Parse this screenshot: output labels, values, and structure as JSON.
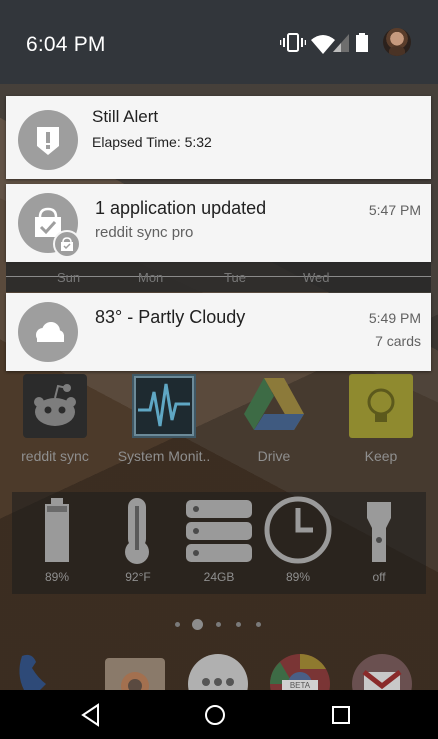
{
  "status_bar": {
    "time": "6:04 PM",
    "icons": [
      "vibrate-icon",
      "wifi-icon",
      "signal-icon",
      "battery-icon",
      "avatar"
    ]
  },
  "notifications": [
    {
      "id": "still-alert",
      "icon": "alert-shield-icon",
      "title": "Still Alert",
      "subtitle": "Elapsed Time: 5:32"
    },
    {
      "id": "app-updated",
      "icon": "shopping-bag-check-icon",
      "title": "1 application updated",
      "subtitle": "reddit sync pro",
      "time": "5:47 PM"
    },
    {
      "id": "weather",
      "icon": "cloud-icon",
      "title": "83° - Partly Cloudy",
      "time": "5:49 PM",
      "extra": "7 cards"
    }
  ],
  "calendar_strip": {
    "days": [
      "Sun",
      "Mon",
      "Tue",
      "Wed"
    ]
  },
  "apps": [
    {
      "label": "reddit sync",
      "icon": "reddit-alien-icon"
    },
    {
      "label": "System Monit..",
      "icon": "system-monitor-icon"
    },
    {
      "label": "Drive",
      "icon": "google-drive-icon"
    },
    {
      "label": "Keep",
      "icon": "keep-bulb-icon"
    }
  ],
  "widget": {
    "items": [
      {
        "label": "89%",
        "icon": "battery-icon"
      },
      {
        "label": "92°F",
        "icon": "thermometer-icon"
      },
      {
        "label": "24GB",
        "icon": "storage-icon"
      },
      {
        "label": "89%",
        "icon": "clock-icon"
      },
      {
        "label": "off",
        "icon": "flashlight-icon"
      }
    ]
  },
  "page_indicator": {
    "pages": 5,
    "current": 2
  },
  "dock": [
    "phone-icon",
    "camera-icon",
    "app-drawer-icon",
    "chrome-beta-icon",
    "gmail-icon"
  ],
  "nav_bar": [
    "back-button",
    "home-button",
    "recents-button"
  ]
}
